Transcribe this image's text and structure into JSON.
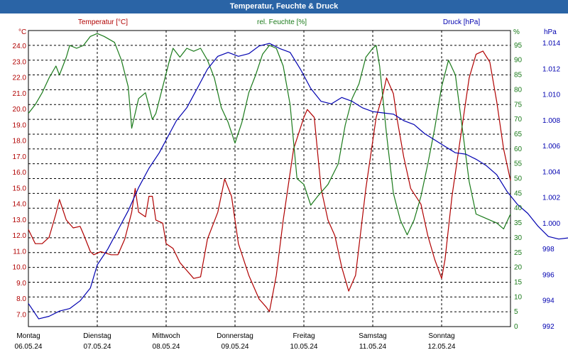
{
  "window": {
    "title": "Temperatur, Feuchte & Druck"
  },
  "colors": {
    "temperature": "#b00000",
    "humidity": "#1a7a1a",
    "pressure": "#0000b0",
    "title_bar": "#2a64a6"
  },
  "chart_data": {
    "type": "line",
    "title": "Temperatur, Feuchte & Druck",
    "grid": true,
    "x_axis": {
      "range": [
        0,
        7
      ],
      "days": [
        {
          "name": "Montag",
          "date": "06.05.24"
        },
        {
          "name": "Dienstag",
          "date": "07.05.24"
        },
        {
          "name": "Mittwoch",
          "date": "08.05.24"
        },
        {
          "name": "Donnerstag",
          "date": "09.05.24"
        },
        {
          "name": "Freitag",
          "date": "10.05.24"
        },
        {
          "name": "Samstag",
          "date": "11.05.24"
        },
        {
          "name": "Sonntag",
          "date": "12.05.24"
        }
      ]
    },
    "axes": {
      "temperature": {
        "label": "Temperatur [°C]",
        "unit": "°C",
        "range": [
          6.25,
          25.0
        ],
        "ticks": [
          "7.0",
          "8.0",
          "9.0",
          "10.0",
          "11.0",
          "12.0",
          "13.0",
          "14.0",
          "15.0",
          "16.0",
          "17.0",
          "18.0",
          "19.0",
          "20.0",
          "21.0",
          "22.0",
          "23.0",
          "24.0"
        ]
      },
      "humidity": {
        "label": "rel. Feuchte [%]",
        "unit": "%",
        "range": [
          0,
          100
        ],
        "ticks": [
          "0",
          "5",
          "10",
          "15",
          "20",
          "25",
          "30",
          "35",
          "40",
          "45",
          "50",
          "55",
          "60",
          "65",
          "70",
          "75",
          "80",
          "85",
          "90",
          "95"
        ]
      },
      "pressure": {
        "label": "Druck [hPa]",
        "unit": "hPa",
        "range": [
          992,
          1015
        ],
        "ticks": [
          "992",
          "994",
          "996",
          "998",
          "1.000",
          "1.002",
          "1.004",
          "1.006",
          "1.008",
          "1.010",
          "1.012",
          "1.014"
        ]
      }
    },
    "series": [
      {
        "name": "Temperatur [°C]",
        "axis": "temperature",
        "points": [
          [
            0,
            12.4
          ],
          [
            0.1,
            11.5
          ],
          [
            0.2,
            11.5
          ],
          [
            0.3,
            11.9
          ],
          [
            0.4,
            13.4
          ],
          [
            0.45,
            14.3
          ],
          [
            0.55,
            13.0
          ],
          [
            0.65,
            12.5
          ],
          [
            0.75,
            12.6
          ],
          [
            0.8,
            12.1
          ],
          [
            0.9,
            11.0
          ],
          [
            0.95,
            10.8
          ],
          [
            1.05,
            11.0
          ],
          [
            1.2,
            10.8
          ],
          [
            1.3,
            10.8
          ],
          [
            1.4,
            11.8
          ],
          [
            1.5,
            13.5
          ],
          [
            1.55,
            15.0
          ],
          [
            1.6,
            13.5
          ],
          [
            1.7,
            13.2
          ],
          [
            1.75,
            14.5
          ],
          [
            1.8,
            14.5
          ],
          [
            1.85,
            13.0
          ],
          [
            1.95,
            12.8
          ],
          [
            2.0,
            11.5
          ],
          [
            2.1,
            11.2
          ],
          [
            2.2,
            10.3
          ],
          [
            2.3,
            9.8
          ],
          [
            2.4,
            9.3
          ],
          [
            2.5,
            9.4
          ],
          [
            2.6,
            11.8
          ],
          [
            2.75,
            13.5
          ],
          [
            2.85,
            15.6
          ],
          [
            2.95,
            14.5
          ],
          [
            3.05,
            11.5
          ],
          [
            3.2,
            9.5
          ],
          [
            3.35,
            8.0
          ],
          [
            3.45,
            7.5
          ],
          [
            3.5,
            7.2
          ],
          [
            3.6,
            9.5
          ],
          [
            3.7,
            13.0
          ],
          [
            3.85,
            17.5
          ],
          [
            4.0,
            19.5
          ],
          [
            4.05,
            20.0
          ],
          [
            4.15,
            19.5
          ],
          [
            4.25,
            15.0
          ],
          [
            4.35,
            13.0
          ],
          [
            4.45,
            12.0
          ],
          [
            4.55,
            10.0
          ],
          [
            4.65,
            8.5
          ],
          [
            4.75,
            9.5
          ],
          [
            4.9,
            15.0
          ],
          [
            5.05,
            19.5
          ],
          [
            5.15,
            21.0
          ],
          [
            5.2,
            22.0
          ],
          [
            5.3,
            21.0
          ],
          [
            5.35,
            19.5
          ],
          [
            5.45,
            17.0
          ],
          [
            5.55,
            15.0
          ],
          [
            5.7,
            14.0
          ],
          [
            5.8,
            12.0
          ],
          [
            5.9,
            10.5
          ],
          [
            6.0,
            9.3
          ],
          [
            6.05,
            10.5
          ],
          [
            6.15,
            14.5
          ],
          [
            6.3,
            19.0
          ],
          [
            6.4,
            22.0
          ],
          [
            6.5,
            23.5
          ],
          [
            6.6,
            23.7
          ],
          [
            6.7,
            23.0
          ],
          [
            6.8,
            20.5
          ],
          [
            6.9,
            17.5
          ],
          [
            7.0,
            15.5
          ]
        ]
      },
      {
        "name": "rel. Feuchte [%]",
        "axis": "humidity",
        "points": [
          [
            0,
            72
          ],
          [
            0.1,
            75
          ],
          [
            0.2,
            79
          ],
          [
            0.3,
            84
          ],
          [
            0.4,
            88
          ],
          [
            0.45,
            85
          ],
          [
            0.55,
            91
          ],
          [
            0.6,
            95
          ],
          [
            0.7,
            94
          ],
          [
            0.8,
            95
          ],
          [
            0.9,
            98
          ],
          [
            1.0,
            99
          ],
          [
            1.1,
            98
          ],
          [
            1.25,
            96
          ],
          [
            1.35,
            90
          ],
          [
            1.45,
            81
          ],
          [
            1.5,
            67
          ],
          [
            1.6,
            77
          ],
          [
            1.7,
            79
          ],
          [
            1.8,
            70
          ],
          [
            1.85,
            72
          ],
          [
            1.95,
            81
          ],
          [
            2.05,
            90
          ],
          [
            2.1,
            94
          ],
          [
            2.2,
            91
          ],
          [
            2.3,
            94
          ],
          [
            2.4,
            93
          ],
          [
            2.5,
            94
          ],
          [
            2.6,
            90
          ],
          [
            2.7,
            84
          ],
          [
            2.8,
            74
          ],
          [
            2.9,
            69
          ],
          [
            3.0,
            62
          ],
          [
            3.1,
            69
          ],
          [
            3.2,
            79
          ],
          [
            3.3,
            85
          ],
          [
            3.4,
            92
          ],
          [
            3.5,
            95
          ],
          [
            3.6,
            94
          ],
          [
            3.7,
            88
          ],
          [
            3.8,
            75
          ],
          [
            3.9,
            50
          ],
          [
            4.0,
            48
          ],
          [
            4.1,
            41
          ],
          [
            4.2,
            44
          ],
          [
            4.35,
            48
          ],
          [
            4.5,
            55
          ],
          [
            4.6,
            68
          ],
          [
            4.7,
            77
          ],
          [
            4.8,
            82
          ],
          [
            4.9,
            91
          ],
          [
            5.0,
            94
          ],
          [
            5.05,
            95
          ],
          [
            5.1,
            88
          ],
          [
            5.2,
            65
          ],
          [
            5.3,
            45
          ],
          [
            5.4,
            36
          ],
          [
            5.5,
            31
          ],
          [
            5.6,
            36
          ],
          [
            5.7,
            44
          ],
          [
            5.8,
            55
          ],
          [
            5.9,
            67
          ],
          [
            6.0,
            81
          ],
          [
            6.1,
            90
          ],
          [
            6.2,
            85
          ],
          [
            6.3,
            67
          ],
          [
            6.4,
            49
          ],
          [
            6.5,
            38
          ],
          [
            6.6,
            37
          ],
          [
            6.7,
            36
          ],
          [
            6.8,
            35
          ],
          [
            6.9,
            33
          ],
          [
            7.0,
            38
          ]
        ]
      },
      {
        "name": "Druck [hPa]",
        "axis": "pressure",
        "points": [
          [
            0,
            993.8
          ],
          [
            0.15,
            992.6
          ],
          [
            0.3,
            992.8
          ],
          [
            0.45,
            993.2
          ],
          [
            0.6,
            993.4
          ],
          [
            0.75,
            994.0
          ],
          [
            0.9,
            995.0
          ],
          [
            1.0,
            996.8
          ],
          [
            1.15,
            998.0
          ],
          [
            1.3,
            999.5
          ],
          [
            1.45,
            1001.0
          ],
          [
            1.6,
            1002.8
          ],
          [
            1.75,
            1004.3
          ],
          [
            1.9,
            1005.5
          ],
          [
            2.05,
            1007.0
          ],
          [
            2.15,
            1008.0
          ],
          [
            2.3,
            1009.0
          ],
          [
            2.45,
            1010.5
          ],
          [
            2.6,
            1012.0
          ],
          [
            2.75,
            1013.0
          ],
          [
            2.9,
            1013.3
          ],
          [
            3.05,
            1013.0
          ],
          [
            3.2,
            1013.2
          ],
          [
            3.35,
            1013.8
          ],
          [
            3.5,
            1014.0
          ],
          [
            3.65,
            1013.6
          ],
          [
            3.8,
            1013.3
          ],
          [
            3.95,
            1012.0
          ],
          [
            4.1,
            1010.5
          ],
          [
            4.25,
            1009.5
          ],
          [
            4.4,
            1009.3
          ],
          [
            4.55,
            1009.8
          ],
          [
            4.7,
            1009.5
          ],
          [
            4.85,
            1009.0
          ],
          [
            5.0,
            1008.7
          ],
          [
            5.15,
            1008.6
          ],
          [
            5.3,
            1008.5
          ],
          [
            5.45,
            1008.0
          ],
          [
            5.6,
            1007.7
          ],
          [
            5.75,
            1007.0
          ],
          [
            5.9,
            1006.5
          ],
          [
            6.05,
            1006.0
          ],
          [
            6.2,
            1005.5
          ],
          [
            6.35,
            1005.4
          ],
          [
            6.5,
            1005.0
          ],
          [
            6.65,
            1004.5
          ],
          [
            6.8,
            1003.8
          ],
          [
            6.95,
            1002.5
          ],
          [
            7.1,
            1001.5
          ],
          [
            7.25,
            1000.8
          ],
          [
            7.4,
            999.8
          ],
          [
            7.55,
            999.0
          ],
          [
            7.7,
            998.8
          ],
          [
            7.85,
            998.9
          ],
          [
            8.0,
            998.9
          ]
        ]
      }
    ]
  }
}
